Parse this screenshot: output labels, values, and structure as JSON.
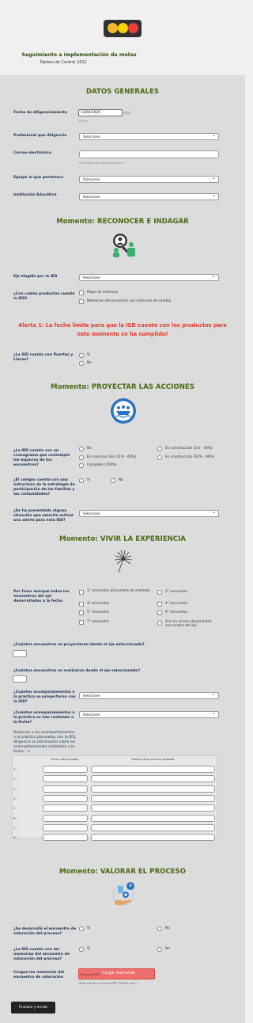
{
  "header": {
    "title": "Seguimiento a implementación de metas",
    "subtitle": "Tablero de Control 2021",
    "lamp_colors": [
      "#f5b82c",
      "#f7d400",
      "#e8403a"
    ]
  },
  "datos": {
    "heading": "DATOS GENERALES",
    "fecha_label": "Fecha de diligenciamiento",
    "fecha_value": "14/04/2026",
    "fecha_hint": "Fecha",
    "profesional_label": "Profesional que diligencia",
    "profesional_value": "Seleccione",
    "correo_label": "Correo electrónico",
    "correo_hint": "correo@dominiodeejemplo.co",
    "equipo_label": "Equipo al que pertenece",
    "equipo_value": "Seleccione",
    "institucion_label": "Institución Educativa",
    "institucion_value": "Seleccione"
  },
  "reconocer": {
    "heading": "Momento: RECONOCER E INDAGAR",
    "icon": "magnifier-people-icon",
    "eje_label": "Eje elegido por la IED",
    "eje_value": "Seleccione",
    "productos_label": "¿Con cuáles productos cuenta la IED?",
    "productos_options": [
      "Mapa de memoria",
      "Memorias del encuentro con intención de cambio"
    ],
    "alert": "Alerta 1: La fecha limite para que la IED cuente con los productos para este momento se ha cumplido!",
    "puertas_label": "¿La IED cuenta con Puertas y Llaves?",
    "puertas_options": [
      "Sí",
      "No"
    ]
  },
  "proyectar": {
    "heading": "Momento: PROYECTAR LAS ACCIONES",
    "icon": "team-boat-icon",
    "crono_label": "¿La IED cuenta con un cronograma que contemple los espacios de los encuentros?",
    "crono_options": [
      "No",
      "En construcción (1% - 30%)",
      "En construcción (31% - 60%)",
      "En construcción (61% - 99%)",
      "Completo (100%)"
    ],
    "colegio_label": "¿El colegio cuenta con una estructura de la estrategia de participación de las familias y las comunidades?",
    "colegio_options": [
      "Sí",
      "No"
    ],
    "alerta_label": "¿Se ha presentado alguna situación que amerite activar una alerta para esta IED?",
    "alerta_value": "Seleccione"
  },
  "vivir": {
    "heading": "Momento: VIVIR LA EXPERIENCIA",
    "icon": "dandelion-icon",
    "encuentros_label": "Por favor marque todos los encuentros del eje desarrollados a la fecha",
    "encuentros_left": [
      "1° encuentro (Encuentro de entrada)",
      "3° encuentro",
      "5° encuentro",
      "7° encuentro"
    ],
    "encuentros_right": [
      "2° encuentro",
      "4° encuentro",
      "6° encuentro",
      "Aún no se han desarrollado encuentros del eje"
    ],
    "proyectaron_label": "¿Cuántos encuentros se proyectaron desde el eje seleccionado?",
    "realizaron_label": "¿Cuántos encuentros se realizaron desde el eje seleccionado?",
    "acomp_proy_label": "¿Cuántos acompañamientos a la práctica se proyectaron con la IED?",
    "acomp_proy_value": "Seleccione",
    "acomp_real_label": "¿Cuántos acompañamientos a la práctica se han realizado a la fecha?",
    "acomp_real_value": "Seleccione",
    "tabla_label": "Respecto a los acompañamientos a la práctica planeados con la IED, diligencie la información sobre los acompañamientos realizados a la fecha - →",
    "tabla_headers": [
      "Fecha (dd/mm/aaaa)",
      "Nombre de la práctica realizada"
    ],
    "tabla_rows": [
      "1°",
      "2°",
      "3°",
      "4°",
      "5°",
      "6°",
      "7°",
      "8°"
    ]
  },
  "valorar": {
    "heading": "Momento: VALORAR EL PROCESO",
    "icon": "gear-hand-icon",
    "desarrollo_label": "¿Se desarrolló el encuentro de valoración del proceso?",
    "desarrollo_options": [
      "Sí",
      "No"
    ],
    "memorias_label": "¿La IED cuenta con las memorias del encuentro de valoración del proceso?",
    "memorias_options": [
      "Sí",
      "No"
    ],
    "cargue_label": "Cargue las memorias del encuentro de valoración",
    "upload_placeholder": "Ninguno PDF",
    "upload_button": "Cargar memorias",
    "upload_hint": "Solo admite archivos PDF (20MB max)",
    "submit": "Finalizar y enviar"
  }
}
